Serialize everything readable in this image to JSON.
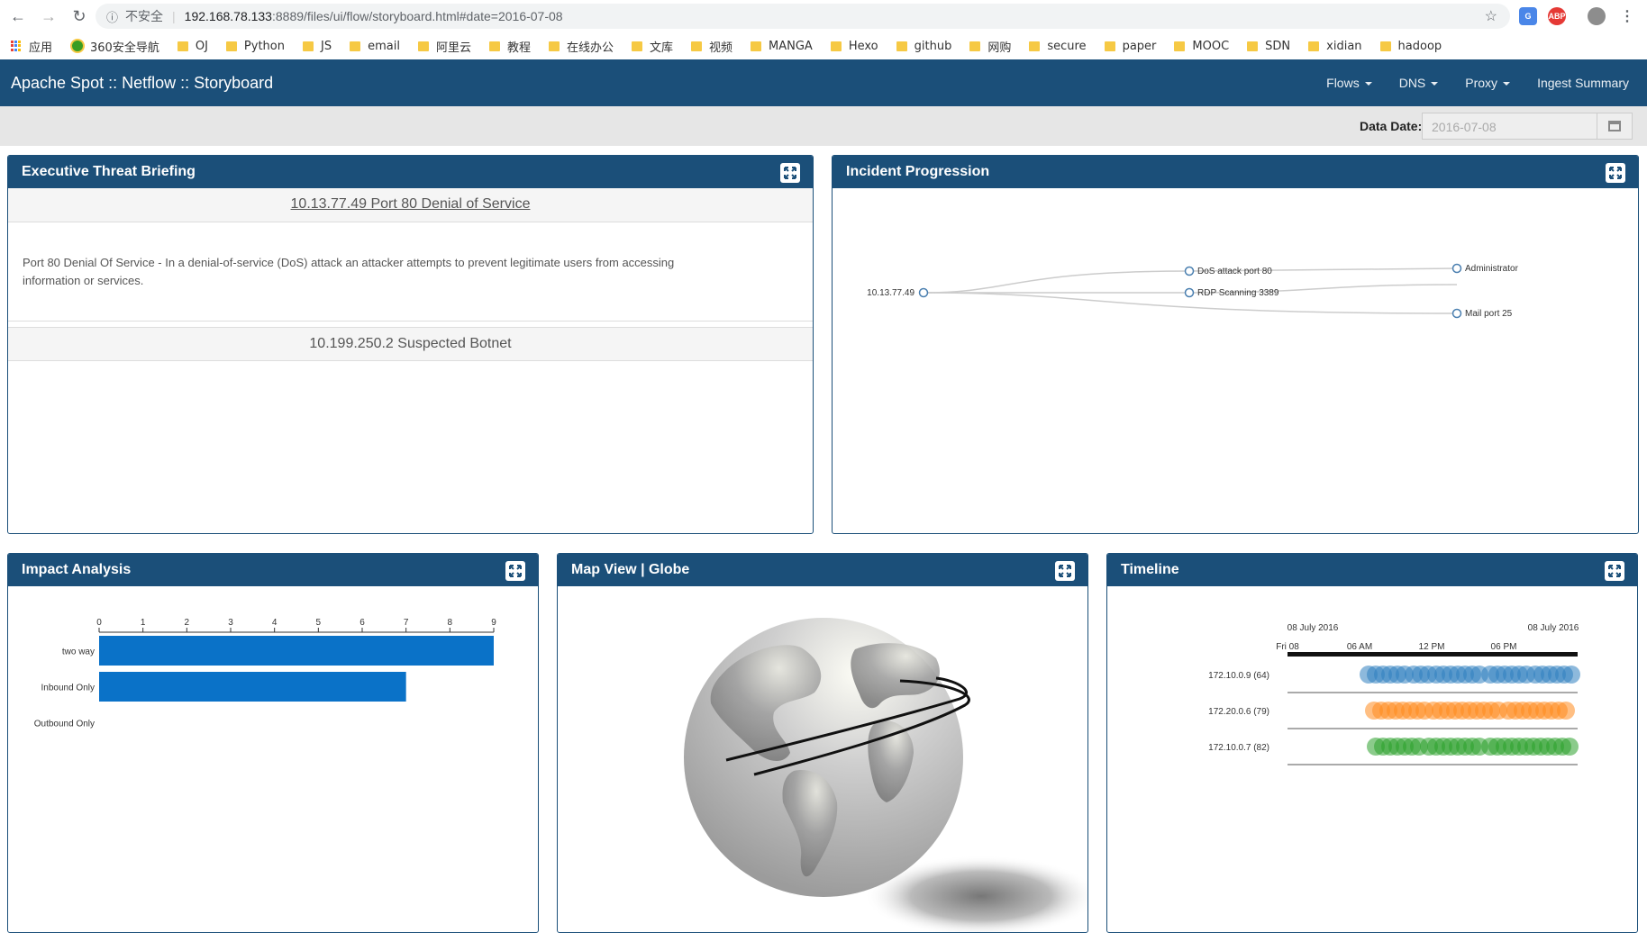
{
  "browser": {
    "insecure_label": "不安全",
    "url_host": "192.168.78.133",
    "url_rest": ":8889/files/ui/flow/storyboard.html#date=2016-07-08",
    "star": "☆"
  },
  "bookmarks": [
    "应用",
    "360安全导航",
    "OJ",
    "Python",
    "JS",
    "email",
    "阿里云",
    "教程",
    "在线办公",
    "文库",
    "视频",
    "MANGA",
    "Hexo",
    "github",
    "网购",
    "secure",
    "paper",
    "MOOC",
    "SDN",
    "xidian",
    "hadoop"
  ],
  "navbar": {
    "brand": "Apache Spot :: Netflow :: Storyboard",
    "menu": [
      {
        "label": "Flows",
        "dropdown": true
      },
      {
        "label": "DNS",
        "dropdown": true
      },
      {
        "label": "Proxy",
        "dropdown": true
      },
      {
        "label": "Ingest Summary",
        "dropdown": false
      }
    ]
  },
  "datebar": {
    "label": "Data Date:",
    "value": "2016-07-08"
  },
  "panels": {
    "executive": {
      "title": "Executive Threat Briefing",
      "threats": [
        {
          "title": "10.13.77.49 Port 80 Denial of Service",
          "description": "Port 80 Denial Of Service - In a denial-of-service (DoS) attack an attacker attempts to prevent legitimate users from accessing information or services."
        },
        {
          "title": "10.199.250.2 Suspected Botnet"
        }
      ]
    },
    "incident": {
      "title": "Incident Progression",
      "root": "10.13.77.49",
      "children": [
        "DoS attack port 80",
        "RDP Scanning 3389"
      ],
      "leaves": [
        "Administrator",
        "Mail port 25"
      ]
    },
    "impact": {
      "title": "Impact Analysis"
    },
    "map": {
      "title": "Map View | Globe"
    },
    "timeline": {
      "title": "Timeline"
    }
  },
  "chart_data": [
    {
      "type": "bar",
      "orientation": "horizontal",
      "categories": [
        "two way",
        "Inbound Only",
        "Outbound Only"
      ],
      "values": [
        9,
        7,
        0
      ],
      "xlim": [
        0,
        9
      ],
      "ticks": [
        0,
        1,
        2,
        3,
        4,
        5,
        6,
        7,
        8,
        9
      ],
      "color": "#0a72c8"
    },
    {
      "type": "timeline",
      "top_labels": [
        "08 July 2016",
        "08 July 2016"
      ],
      "ticks": [
        "Fri 08",
        "06 AM",
        "12 PM",
        "06 PM"
      ],
      "series": [
        {
          "name": "172.10.0.9 (64)",
          "color": "#2f7fc0"
        },
        {
          "name": "172.20.0.6 (79)",
          "color": "#ff8a1e"
        },
        {
          "name": "172.10.0.7 (82)",
          "color": "#2ca02c"
        }
      ]
    }
  ]
}
